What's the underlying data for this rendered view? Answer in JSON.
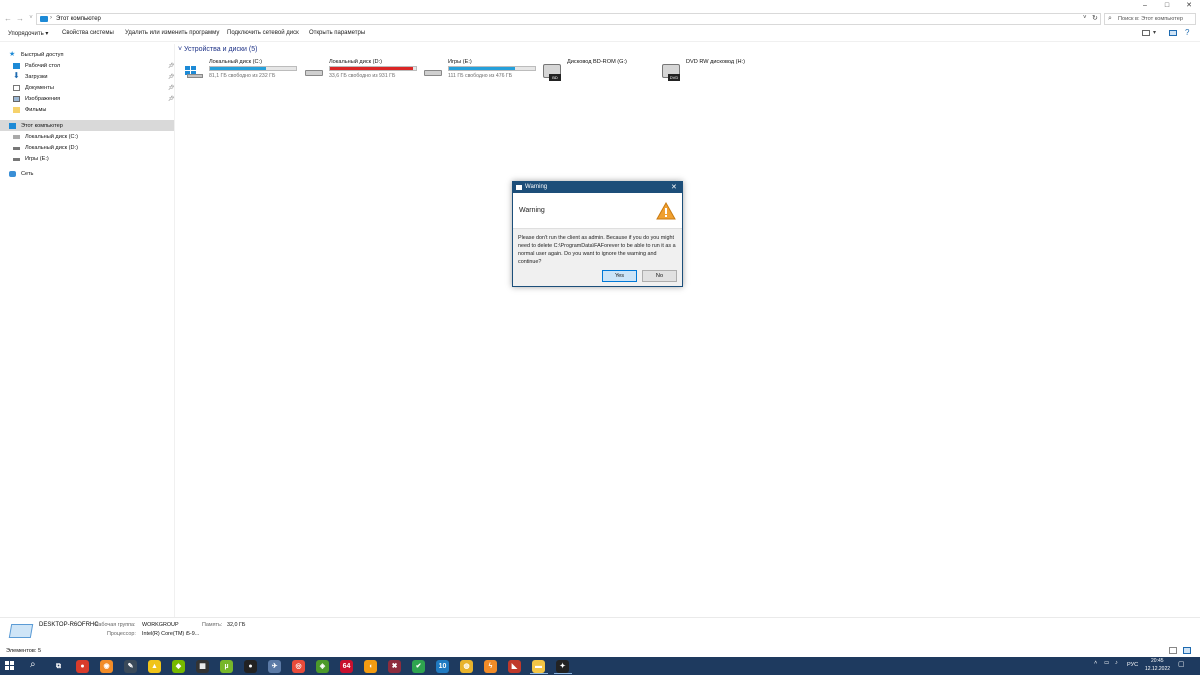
{
  "window": {
    "minimize": "–",
    "maximize": "□",
    "close": "✕"
  },
  "address": {
    "path": "Этот компьютер",
    "search_placeholder": "Поиск в: Этот компьютер"
  },
  "toolbar": {
    "organize": "Упорядочить ▾",
    "system_properties": "Свойства системы",
    "uninstall": "Удалить или изменить программу",
    "map_drive": "Подключить сетевой диск",
    "open_settings": "Открыть параметры"
  },
  "sidebar": {
    "quick_access": "Быстрый доступ",
    "items": [
      {
        "label": "Рабочий стол",
        "icon": "desktop-icon"
      },
      {
        "label": "Загрузки",
        "icon": "download-icon"
      },
      {
        "label": "Документы",
        "icon": "documents-icon"
      },
      {
        "label": "Изображения",
        "icon": "pictures-icon"
      },
      {
        "label": "Фильмы",
        "icon": "folder-icon"
      }
    ],
    "this_pc": "Этот компьютер",
    "drives": [
      {
        "label": "Локальный диск (C:)"
      },
      {
        "label": "Локальный диск (D:)"
      },
      {
        "label": "Игры (E:)"
      }
    ],
    "network": "Сеть"
  },
  "content": {
    "group_header": "Устройства и диски (5)",
    "drives": [
      {
        "name": "Локальный диск (C:)",
        "free": "81,1 ГБ свободно из 232 ГБ",
        "used_fraction": 0.65,
        "bar_color": "#26a0da"
      },
      {
        "name": "Локальный диск (D:)",
        "free": "33,6 ГБ свободно из 931 ГБ",
        "used_fraction": 0.96,
        "bar_color": "#da2626"
      },
      {
        "name": "Игры (E:)",
        "free": "111 ГБ свободно из 476 ГБ",
        "used_fraction": 0.77,
        "bar_color": "#26a0da"
      },
      {
        "name": "Дисковод BD-ROM (G:)",
        "badge": "BD"
      },
      {
        "name": "DVD RW дисковод (H:)",
        "badge": "DVD"
      }
    ]
  },
  "details": {
    "computer_name": "DESKTOP-R6OFRHC",
    "workgroup_label": "Рабочая группа:",
    "workgroup_value": "WORKGROUP",
    "memory_label": "Память:",
    "memory_value": "32,0 ГБ",
    "cpu_label": "Процессор:",
    "cpu_value": "Intel(R) Core(TM) i5-9..."
  },
  "status": {
    "items": "Элементов: 5"
  },
  "dialog": {
    "title": "Warning",
    "heading": "Warning",
    "message": "Please don't run the client as admin. Because if you do you might need to delete C:\\ProgramData\\FAForever to be able to run it as a normal user again. Do you want to ignore the warning and continue?",
    "yes": "Yes",
    "no": "No"
  },
  "taskbar": {
    "apps": [
      {
        "name": "task-view-icon",
        "glyph": "⧉",
        "color": "#1e3a5f"
      },
      {
        "name": "game-app-icon",
        "glyph": "●",
        "color": "#d83b2b"
      },
      {
        "name": "camera-app-icon",
        "glyph": "◉",
        "color": "#f28c28"
      },
      {
        "name": "pencil-app-icon",
        "glyph": "✎",
        "color": "#3a4a5a"
      },
      {
        "name": "warning-app-icon",
        "glyph": "▲",
        "color": "#f0c419"
      },
      {
        "name": "nvidia-icon",
        "glyph": "◆",
        "color": "#76b900"
      },
      {
        "name": "clapper-icon",
        "glyph": "▦",
        "color": "#333333"
      },
      {
        "name": "utorrent-icon",
        "glyph": "µ",
        "color": "#77b72a"
      },
      {
        "name": "panda-icon",
        "glyph": "●",
        "color": "#222222"
      },
      {
        "name": "satellite-icon",
        "glyph": "✈",
        "color": "#5b7aa6"
      },
      {
        "name": "lifebuoy-icon",
        "glyph": "◎",
        "color": "#e84b3a"
      },
      {
        "name": "map-app-icon",
        "glyph": "◈",
        "color": "#4c9a2a"
      },
      {
        "name": "aida64-icon",
        "glyph": "64",
        "color": "#c8102e"
      },
      {
        "name": "fish-app-icon",
        "glyph": "◖",
        "color": "#f39c12"
      },
      {
        "name": "x-app-icon",
        "glyph": "✖",
        "color": "#8e2c3d"
      },
      {
        "name": "shield-app-icon",
        "glyph": "✔",
        "color": "#2ea44f"
      },
      {
        "name": "ten-app-icon",
        "glyph": "10",
        "color": "#1f7ac2"
      },
      {
        "name": "chrome-icon",
        "glyph": "◍",
        "color": "#e8b32c"
      },
      {
        "name": "lightning-app-icon",
        "glyph": "ϟ",
        "color": "#f28c28"
      },
      {
        "name": "racing-app-icon",
        "glyph": "◣",
        "color": "#c0392b"
      },
      {
        "name": "explorer-icon",
        "glyph": "▬",
        "color": "#f3c545"
      },
      {
        "name": "faf-icon",
        "glyph": "✦",
        "color": "#222222"
      }
    ],
    "lang": "РУС",
    "time": "20:45",
    "date": "12.12.2022"
  }
}
